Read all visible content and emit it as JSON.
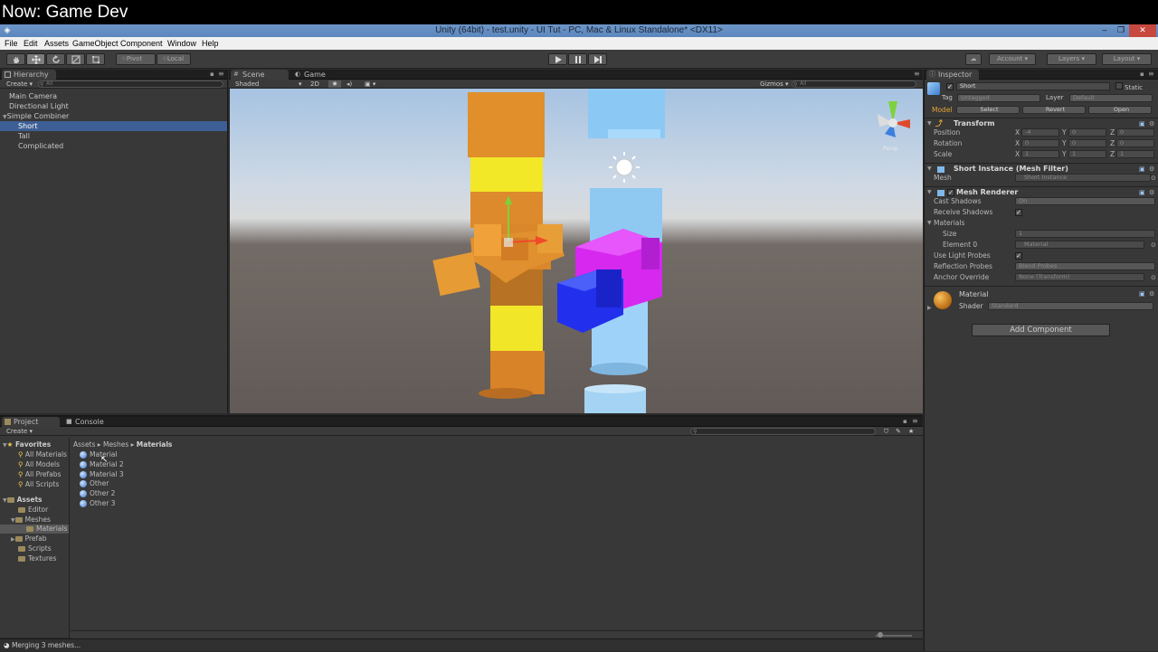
{
  "banner": {
    "title": "Now: Game Dev"
  },
  "window": {
    "title": "Unity (64bit) - test.unity - UI Tut - PC, Mac & Linux Standalone* <DX11>",
    "minimize": "–",
    "maximize": "❐",
    "close": "✕"
  },
  "menu": [
    "File",
    "Edit",
    "Assets",
    "GameObject",
    "Component",
    "Window",
    "Help"
  ],
  "toolbar": {
    "pivot": "Pivot",
    "local": "Local",
    "account": "Account",
    "layers": "Layers",
    "layout": "Layout"
  },
  "hierarchy": {
    "tab": "Hierarchy",
    "create": "Create",
    "search_placeholder": "All",
    "items": [
      "Main Camera",
      "Directional Light",
      "Simple Combiner",
      "Short",
      "Tall",
      "Complicated"
    ]
  },
  "scene": {
    "tabs": [
      "Scene",
      "Game"
    ],
    "shading": "Shaded",
    "mode_2d": "2D",
    "gizmos": "Gizmos",
    "search_placeholder": "All",
    "persp": "Persp"
  },
  "inspector": {
    "tab": "Inspector",
    "object_name": "Short",
    "static": "Static",
    "tag_label": "Tag",
    "tag_value": "Untagged",
    "layer_label": "Layer",
    "layer_value": "Default",
    "model_label": "Model",
    "model_buttons": [
      "Select",
      "Revert",
      "Open"
    ],
    "transform": {
      "title": "Transform",
      "position": {
        "label": "Position",
        "x": "-4",
        "y": "0",
        "z": "0"
      },
      "rotation": {
        "label": "Rotation",
        "x": "0",
        "y": "0",
        "z": "0"
      },
      "scale": {
        "label": "Scale",
        "x": "1",
        "y": "1",
        "z": "1"
      }
    },
    "mesh_filter": {
      "title": "Short Instance (Mesh Filter)",
      "mesh_label": "Mesh",
      "mesh_value": "Short Instance"
    },
    "mesh_renderer": {
      "title": "Mesh Renderer",
      "cast_shadows_label": "Cast Shadows",
      "cast_shadows_value": "On",
      "receive_shadows_label": "Receive Shadows",
      "materials_label": "Materials",
      "size_label": "Size",
      "size_value": "1",
      "element0_label": "Element 0",
      "element0_value": "Material",
      "light_probes_label": "Use Light Probes",
      "reflection_label": "Reflection Probes",
      "reflection_value": "Blend Probes",
      "anchor_label": "Anchor Override",
      "anchor_value": "None (Transform)"
    },
    "material": {
      "title": "Material",
      "shader_label": "Shader",
      "shader_value": "Standard"
    },
    "add_component": "Add Component"
  },
  "project": {
    "tabs": [
      "Project",
      "Console"
    ],
    "create": "Create",
    "breadcrumb": [
      "Assets",
      "Meshes",
      "Materials"
    ],
    "favorites_title": "Favorites",
    "favorites": [
      "All Materials",
      "All Models",
      "All Prefabs",
      "All Scripts"
    ],
    "assets_title": "Assets",
    "folders": [
      "Editor",
      "Meshes",
      "Materials",
      "Prefab",
      "Scripts",
      "Textures"
    ],
    "files": [
      "Material",
      "Material 2",
      "Material 3",
      "Other",
      "Other 2",
      "Other 3"
    ]
  },
  "status": {
    "text": "Merging 3 meshes..."
  }
}
